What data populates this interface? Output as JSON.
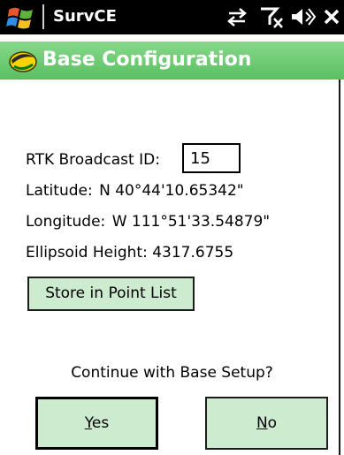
{
  "status_bar": {
    "app_name": "SurvCE",
    "icons": [
      "windows-start-icon",
      "sync-icon",
      "no-signal-icon",
      "speaker-icon",
      "close-icon"
    ]
  },
  "window": {
    "title": "Base Configuration",
    "title_icon": "survce-logo-icon"
  },
  "form": {
    "rtk_label": "RTK Broadcast ID:",
    "rtk_value": "15",
    "latitude_label": "Latitude:",
    "latitude_value": "N 40°44'10.65342\"",
    "longitude_label": "Longitude:",
    "longitude_value": "W 111°51'33.54879\"",
    "height_label": "Ellipsoid Height:",
    "height_value": "4317.6755"
  },
  "buttons": {
    "store": "Store in Point List",
    "yes_mnemonic": "Y",
    "yes_rest": "es",
    "no_mnemonic": "N",
    "no_rest": "o"
  },
  "prompt": "Continue with Base Setup?",
  "colors": {
    "status_bar_bg": "#000000",
    "title_bar_bg": "#6cc872",
    "button_bg": "#cdeccf"
  }
}
